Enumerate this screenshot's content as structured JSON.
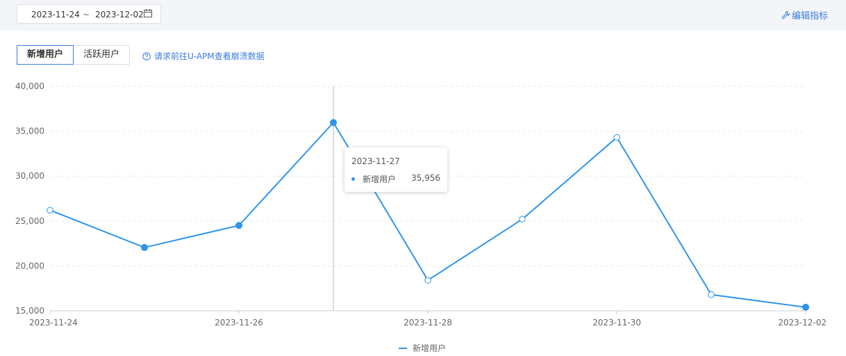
{
  "date_range": {
    "start": "2023-11-24",
    "separator": "~",
    "end": "2023-12-02"
  },
  "edit_link": "编辑指标",
  "tabs": [
    {
      "label": "新增用户",
      "active": true
    },
    {
      "label": "活跃用户",
      "active": false
    }
  ],
  "apm_link": "请求前往U-APM查看崩溃数据",
  "tooltip": {
    "date": "2023-11-27",
    "series": "新增用户",
    "value": "35,956"
  },
  "chart_data": {
    "type": "line",
    "x": [
      "2023-11-24",
      "2023-11-25",
      "2023-11-26",
      "2023-11-27",
      "2023-11-28",
      "2023-11-29",
      "2023-11-30",
      "2023-12-01",
      "2023-12-02"
    ],
    "x_tick_labels": [
      "2023-11-24",
      "2023-11-26",
      "2023-11-28",
      "2023-11-30",
      "2023-12-02"
    ],
    "series": [
      {
        "name": "新增用户",
        "values": [
          26200,
          22050,
          24500,
          35956,
          18400,
          25200,
          34300,
          16800,
          15400
        ]
      }
    ],
    "ylim": [
      15000,
      40000
    ],
    "y_ticks": [
      15000,
      20000,
      25000,
      30000,
      35000,
      40000
    ],
    "y_tick_labels": [
      "15,000",
      "20,000",
      "25,000",
      "30,000",
      "35,000",
      "40,000"
    ],
    "filled_points": [
      1,
      2,
      3,
      8
    ],
    "highlight_index": 3,
    "grid": true,
    "legend": "bottom-center",
    "color": "#2e95eb"
  }
}
